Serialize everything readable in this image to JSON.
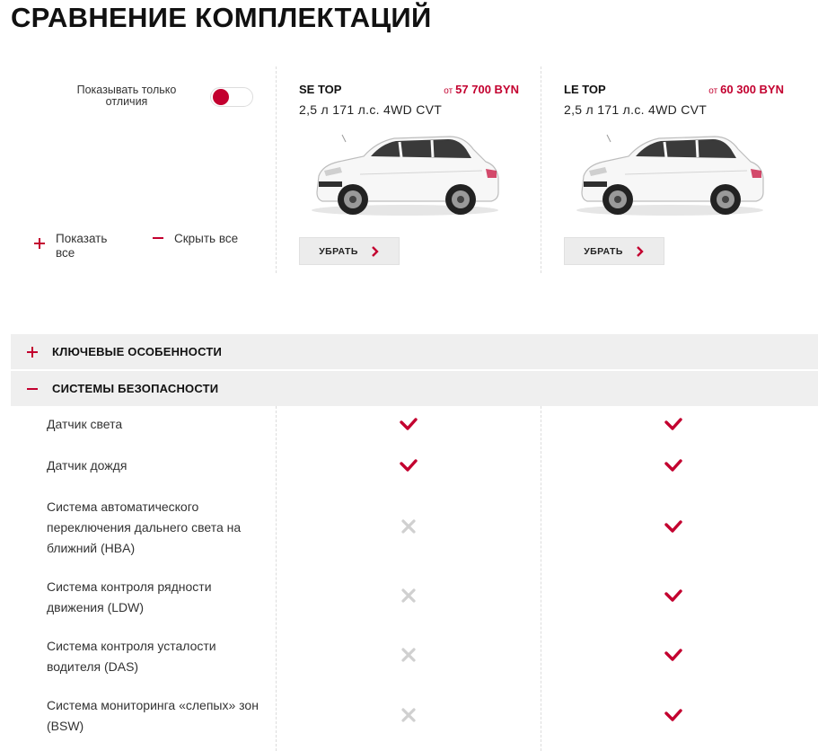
{
  "page": {
    "title": "Сравнение комплектаций"
  },
  "controls": {
    "only_differences_label": "Показывать только отличия",
    "only_differences_on": true,
    "show_all_label": "Показать все",
    "hide_all_label": "Скрыть все"
  },
  "trims": [
    {
      "name": "SE TOP",
      "price_prefix": "от",
      "price": "57 700 BYN",
      "spec": "2,5 л 171 л.с. 4WD CVT",
      "remove_label": "УБРАТЬ",
      "car_color": "white"
    },
    {
      "name": "LE TOP",
      "price_prefix": "от",
      "price": "60 300 BYN",
      "spec": "2,5 л 171 л.с. 4WD CVT",
      "remove_label": "УБРАТЬ",
      "car_color": "white"
    }
  ],
  "sections": [
    {
      "title": "Ключевые особенности",
      "expanded": false,
      "icon": "plus-icon"
    },
    {
      "title": "Системы безопасности",
      "expanded": true,
      "icon": "minus-icon"
    }
  ],
  "features": [
    {
      "label": "Датчик света",
      "values": [
        true,
        true
      ]
    },
    {
      "label": "Датчик дождя",
      "values": [
        true,
        true
      ]
    },
    {
      "label": "Система автоматического переключения дальнего света на ближний (HBA)",
      "values": [
        false,
        true
      ]
    },
    {
      "label": "Система контроля рядности движения (LDW)",
      "values": [
        false,
        true
      ]
    },
    {
      "label": "Система контроля усталости водителя (DAS)",
      "values": [
        false,
        true
      ]
    },
    {
      "label": "Система мониторинга «слепых» зон (BSW)",
      "values": [
        false,
        true
      ]
    }
  ],
  "colors": {
    "accent": "#c3002f",
    "check": "#c3002f",
    "cross": "#d0d0d0",
    "section_bg": "#efefef"
  }
}
